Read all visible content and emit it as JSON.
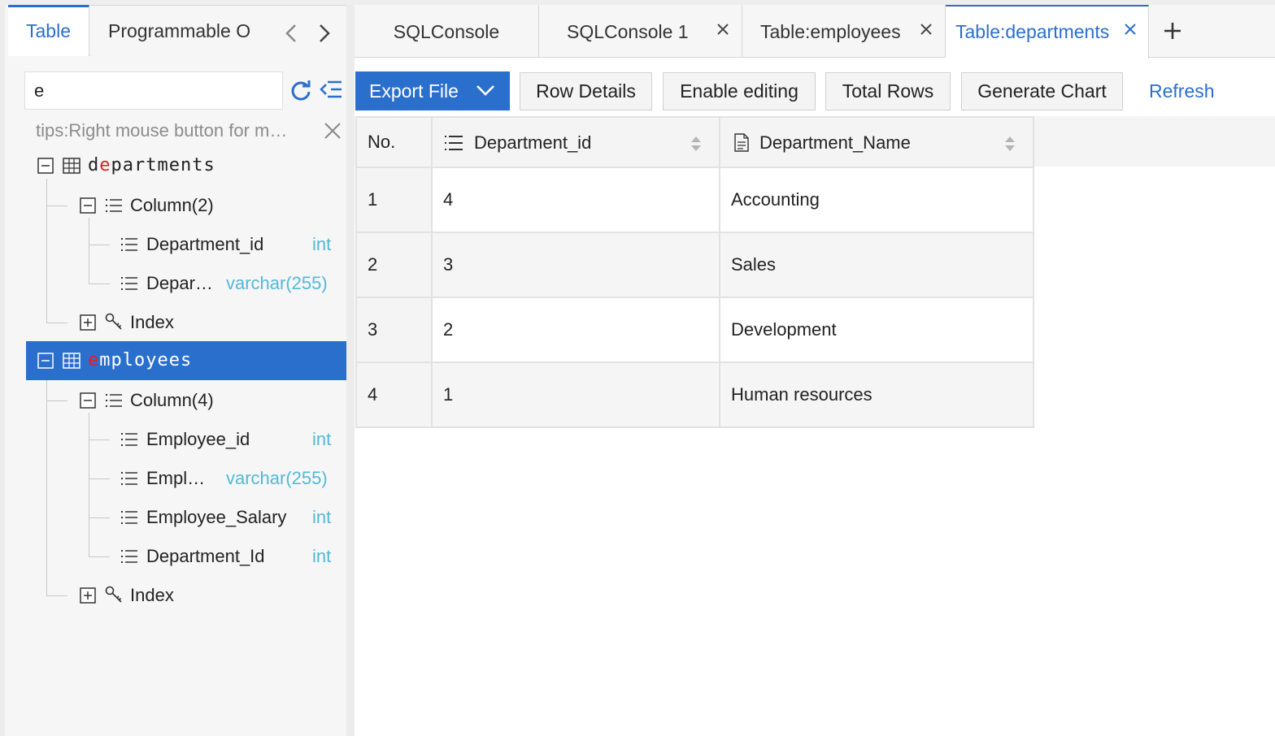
{
  "left_panel": {
    "tabs": [
      {
        "label": "Table"
      },
      {
        "label": "Programmable O"
      }
    ],
    "search": {
      "value": "e"
    },
    "tips": "tips:Right mouse button for m…",
    "tree": {
      "departments": {
        "name_prefix": "d",
        "name_match": "e",
        "name_rest": "partments",
        "column_group": "Column(2)",
        "columns": [
          {
            "name": "Department_id",
            "type": "int"
          },
          {
            "name": "Depar…",
            "type": "varchar(255)"
          }
        ],
        "index_label": "Index"
      },
      "employees": {
        "name_match": "e",
        "name_rest": "mployees",
        "column_group": "Column(4)",
        "columns": [
          {
            "name": "Employee_id",
            "type": "int"
          },
          {
            "name": "Empl…",
            "type": "varchar(255)"
          },
          {
            "name": "Employee_Salary",
            "type": "int"
          },
          {
            "name": "Department_Id",
            "type": "int"
          }
        ],
        "index_label": "Index"
      }
    }
  },
  "editor_tabs": [
    {
      "label": "SQLConsole"
    },
    {
      "label": "SQLConsole 1"
    },
    {
      "label": "Table:employees"
    },
    {
      "label": "Table:departments"
    }
  ],
  "toolbar": {
    "export_label": "Export File",
    "row_details_label": "Row Details",
    "enable_editing_label": "Enable editing",
    "total_rows_label": "Total Rows",
    "generate_chart_label": "Generate Chart",
    "refresh_label": "Refresh"
  },
  "grid": {
    "headers": [
      "No.",
      "Department_id",
      "Department_Name"
    ],
    "rows": [
      [
        "1",
        "4",
        "Accounting"
      ],
      [
        "2",
        "3",
        "Sales"
      ],
      [
        "3",
        "2",
        "Development"
      ],
      [
        "4",
        "1",
        "Human resources"
      ]
    ]
  },
  "colors": {
    "accent": "#2b6fcc",
    "type_text": "#52b9d6",
    "match_highlight": "#e02020"
  }
}
